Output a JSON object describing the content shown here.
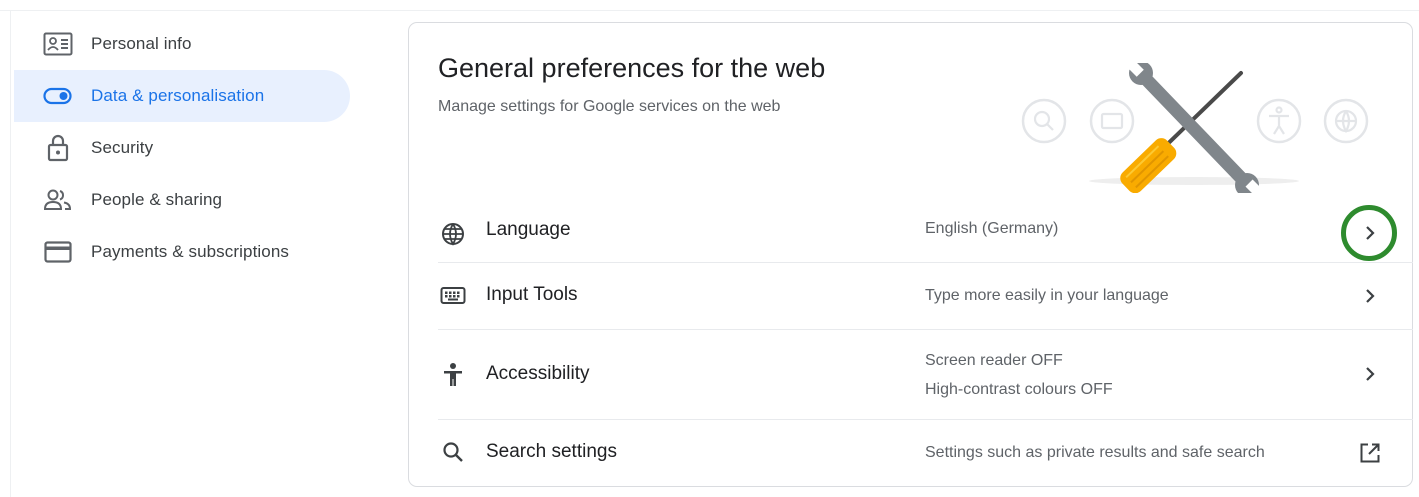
{
  "sidebar": {
    "items": [
      {
        "label": "Personal info",
        "icon": "id-card-icon",
        "active": false
      },
      {
        "label": "Data & personalisation",
        "icon": "toggle-icon",
        "active": true
      },
      {
        "label": "Security",
        "icon": "lock-icon",
        "active": false
      },
      {
        "label": "People & sharing",
        "icon": "people-icon",
        "active": false
      },
      {
        "label": "Payments & subscriptions",
        "icon": "credit-card-icon",
        "active": false
      }
    ]
  },
  "main": {
    "title": "General preferences for the web",
    "subtitle": "Manage settings for Google services on the web",
    "rows": [
      {
        "label": "Language",
        "icon": "globe-icon",
        "value": "English (Germany)",
        "action": "chevron-right-icon"
      },
      {
        "label": "Input Tools",
        "icon": "keyboard-icon",
        "value": "Type more easily in your language",
        "action": "chevron-right-icon"
      },
      {
        "label": "Accessibility",
        "icon": "accessibility-icon",
        "value_lines": [
          "Screen reader OFF",
          "High-contrast colours OFF"
        ],
        "action": "chevron-right-icon"
      },
      {
        "label": "Search settings",
        "icon": "search-icon",
        "value": "Settings such as private results and safe search",
        "action": "open-external-icon"
      }
    ]
  },
  "colors": {
    "accent": "#1a73e8",
    "active_bg": "#e8f0fe",
    "highlight_ring": "#2e8b2e",
    "screwdriver_handle": "#f9ab00"
  }
}
